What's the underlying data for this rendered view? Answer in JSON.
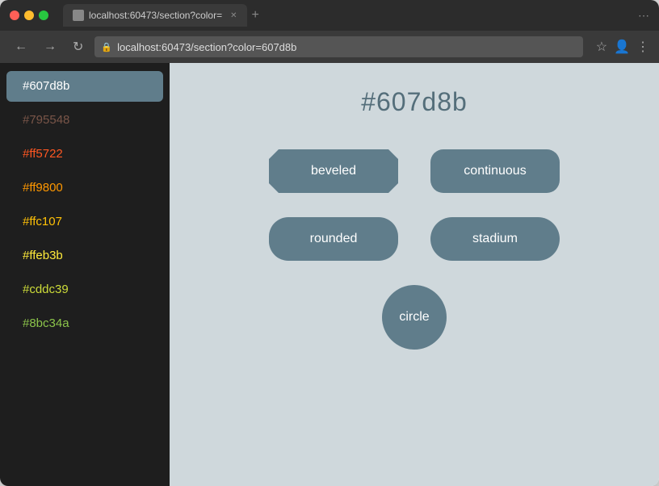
{
  "browser": {
    "url": "localhost:60473/section?color=607d8b",
    "tab_label": "localhost:60473/section?color=",
    "back_label": "←",
    "forward_label": "→",
    "reload_label": "↻"
  },
  "sidebar": {
    "items": [
      {
        "id": "607d8b",
        "label": "#607d8b",
        "color": "#607d8b",
        "active": true
      },
      {
        "id": "795548",
        "label": "#795548",
        "color": "#795548",
        "active": false
      },
      {
        "id": "ff5722",
        "label": "#ff5722",
        "color": "#ff5722",
        "active": false
      },
      {
        "id": "ff9800",
        "label": "#ff9800",
        "color": "#ff9800",
        "active": false
      },
      {
        "id": "ffc107",
        "label": "#ffc107",
        "color": "#ffc107",
        "active": false
      },
      {
        "id": "ffeb3b",
        "label": "#ffeb3b",
        "color": "#ffeb3b",
        "active": false
      },
      {
        "id": "cddc39",
        "label": "#cddc39",
        "color": "#cddc39",
        "active": false
      },
      {
        "id": "8bc34a",
        "label": "#8bc34a",
        "color": "#8bc34a",
        "active": false
      }
    ]
  },
  "page": {
    "color_label": "#607d8b",
    "shapes": [
      {
        "id": "beveled",
        "label": "beveled",
        "shape_class": "beveled"
      },
      {
        "id": "continuous",
        "label": "continuous",
        "shape_class": "continuous"
      },
      {
        "id": "rounded",
        "label": "rounded",
        "shape_class": "rounded"
      },
      {
        "id": "stadium",
        "label": "stadium",
        "shape_class": "stadium"
      }
    ],
    "circle_label": "circle"
  }
}
